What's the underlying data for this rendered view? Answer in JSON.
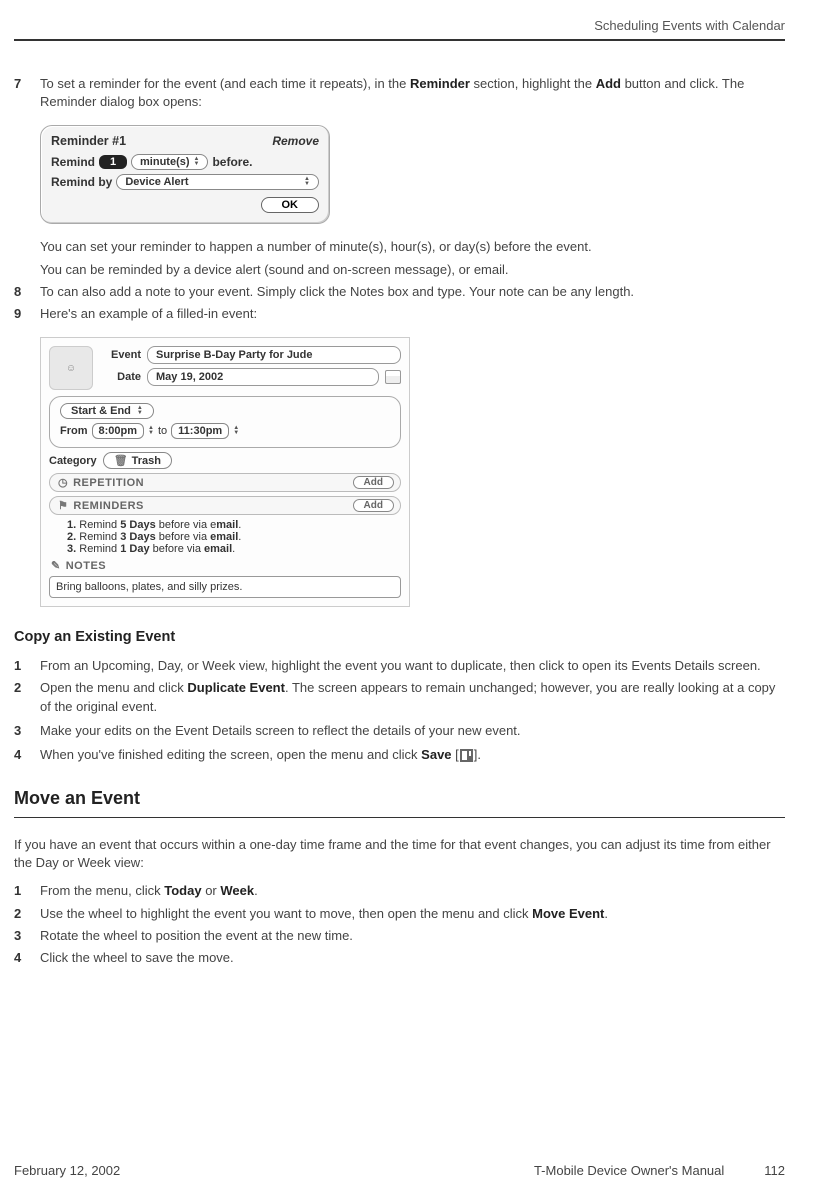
{
  "header": {
    "chapter_title": "Scheduling Events with Calendar"
  },
  "steps_a": {
    "7": {
      "num": "7",
      "text_before": "To set a reminder for the event (and each time it repeats), in the ",
      "bold1": "Reminder",
      "text_mid": " section, highlight the ",
      "bold2": "Add",
      "text_after": " button and click. The Reminder dialog box opens:"
    },
    "after7_a": "You can set your reminder to happen a number of minute(s), hour(s), or day(s) before the event.",
    "after7_b": "You can be reminded by a device alert (sound and on-screen message), or email.",
    "8": {
      "num": "8",
      "text": "To can also add a note to your event. Simply click the Notes box and type. Your note can be any length."
    },
    "9": {
      "num": "9",
      "text": "Here's an example of a filled-in event:"
    }
  },
  "reminder_dialog": {
    "title": "Reminder #1",
    "remove": "Remove",
    "remind_label": "Remind",
    "remind_value": "1",
    "unit": "minute(s)",
    "before": "before.",
    "remind_by_label": "Remind by",
    "remind_by_value": "Device Alert",
    "ok": "OK"
  },
  "event_dialog": {
    "event_label": "Event",
    "event_value": "Surprise B-Day Party for Jude",
    "date_label": "Date",
    "date_value": "May 19, 2002",
    "startend_label": "Start & End",
    "from_label": "From",
    "from_value": "8:00pm",
    "to_label": "to",
    "to_value": "11:30pm",
    "category_label": "Category",
    "category_value": "Trash",
    "repetition_label": "REPETITION",
    "reminders_label": "REMINDERS",
    "add_label": "Add",
    "reminders": [
      {
        "n": "1.",
        "pre": "Remind ",
        "bold": "5 Days",
        "mid": " before via e",
        "bold2": "mail",
        "post": "."
      },
      {
        "n": "2.",
        "pre": "Remind ",
        "bold": "3 Days",
        "mid": " before via ",
        "bold2": "email",
        "post": "."
      },
      {
        "n": "3.",
        "pre": "Remind ",
        "bold": "1 Day",
        "mid": " before via ",
        "bold2": "email",
        "post": "."
      }
    ],
    "notes_label": "NOTES",
    "notes_value": "Bring balloons, plates, and silly prizes."
  },
  "copy_section": {
    "heading": "Copy an Existing Event",
    "1": {
      "num": "1",
      "text": "From an Upcoming, Day, or Week view, highlight the event you want to duplicate, then click to open its Events Details screen."
    },
    "2": {
      "num": "2",
      "before": "Open the menu and click ",
      "bold": "Duplicate Event",
      "after": ". The screen appears to remain unchanged; however, you are really looking at a copy of the original event."
    },
    "3": {
      "num": "3",
      "text": "Make your edits on the Event Details screen to reflect the details of your new event."
    },
    "4": {
      "num": "4",
      "before": "When you've finished editing the screen, open the menu and click ",
      "bold": "Save",
      "bracket_open": " [",
      "bracket_close": "]."
    }
  },
  "move_section": {
    "heading": "Move an Event",
    "intro": "If you have an event that occurs within a one-day time frame and the time for that event changes, you can adjust its time from either the Day or Week view:",
    "1": {
      "num": "1",
      "before": "From the menu, click ",
      "bold1": "Today",
      "mid": " or ",
      "bold2": "Week",
      "after": "."
    },
    "2": {
      "num": "2",
      "before": "Use the wheel to highlight the event you want to move, then open the menu and click ",
      "bold": "Move Event",
      "after": "."
    },
    "3": {
      "num": "3",
      "text": "Rotate the wheel to position the event at the new time."
    },
    "4": {
      "num": "4",
      "text": "Click the wheel to save the move."
    }
  },
  "footer": {
    "date": "February 12, 2002",
    "doc_title": "T-Mobile Device Owner's Manual",
    "page": "112"
  }
}
